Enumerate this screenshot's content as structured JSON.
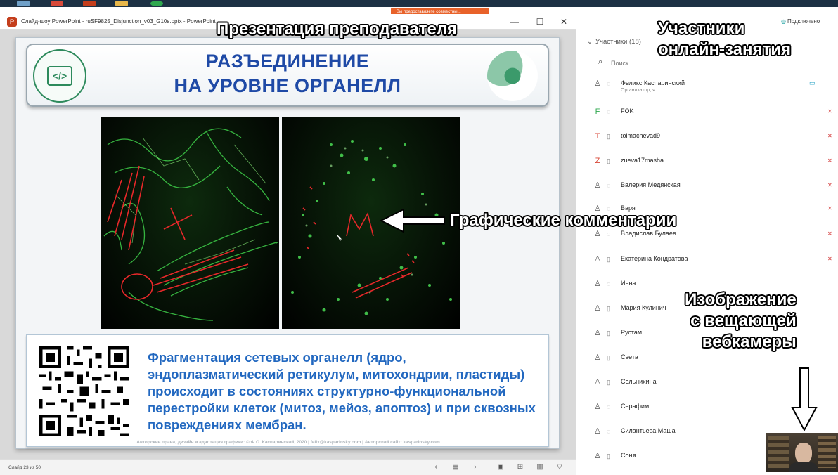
{
  "taskbar": {
    "share_notice": "Вы предоставляете совместны..."
  },
  "ppt_window": {
    "title": "Слайд-шоу PowerPoint - ruSF9825_Disjunction_v03_G10s.pptx - PowerPoint",
    "minimize_label": "—",
    "restore_label": "☐",
    "close_label": "✕",
    "slide": {
      "title_line1": "РАЗЪЕДИНЕНИЕ",
      "title_line2": "НА УРОВНЕ ОРГАНЕЛЛ",
      "body_text": "Фрагментация сетевых органелл (ядро, эндоплазматический ретикулум, митохондрии, пластиды) происходит в состояниях структурно-функциональной перестройки клеток (митоз, мейоз, апоптоз) и при сквозных повреждениях мембран.",
      "footer": "Авторские права, дизайн и адаптация графики: © Ф.О. Каспаринский, 2020 | felix@kasparinsky.com | Авторский сайт: kasparinsky.com"
    },
    "status": {
      "slide_counter": "Слайд 23 из 50",
      "prev_label": "‹",
      "notes_label": "▤",
      "next_label": "›",
      "normal_view_label": "▣",
      "sorter_view_label": "⊞",
      "reading_view_label": "▥",
      "slideshow_label": "▽"
    }
  },
  "panel": {
    "connected_label": "Подключено",
    "participants_header": "Участники (18)",
    "search_placeholder": "Поиск",
    "participants": [
      {
        "avatar": "♙",
        "name": "Феликс Каспаринский",
        "role": "Организатор, я",
        "device": "◌"
      },
      {
        "avatar": "F",
        "name": "FOK",
        "role": "",
        "device": "◌"
      },
      {
        "avatar": "T",
        "name": "tolmachevad9",
        "role": "",
        "device": "▯"
      },
      {
        "avatar": "Z",
        "name": "zueva17masha",
        "role": "",
        "device": "▯"
      },
      {
        "avatar": "♙",
        "name": "Валерия Медянская",
        "role": "",
        "device": "◌"
      },
      {
        "avatar": "♙",
        "name": "Варя",
        "role": "",
        "device": "◌"
      },
      {
        "avatar": "♙",
        "name": "Владислав Булаев",
        "role": "",
        "device": "◌"
      },
      {
        "avatar": "♙",
        "name": "Екатерина Кондратова",
        "role": "",
        "device": "▯"
      },
      {
        "avatar": "♙",
        "name": "Инна",
        "role": "",
        "device": "◌"
      },
      {
        "avatar": "♙",
        "name": "Мария Кулинич",
        "role": "",
        "device": "▯"
      },
      {
        "avatar": "♙",
        "name": "Рустам",
        "role": "",
        "device": "▯"
      },
      {
        "avatar": "♙",
        "name": "Света",
        "role": "",
        "device": "▯"
      },
      {
        "avatar": "♙",
        "name": "Сельнихина",
        "role": "",
        "device": "▯"
      },
      {
        "avatar": "♙",
        "name": "Серафим",
        "role": "",
        "device": "◌"
      },
      {
        "avatar": "♙",
        "name": "Силантьева Маша",
        "role": "",
        "device": "◌"
      },
      {
        "avatar": "♙",
        "name": "Соня",
        "role": "",
        "device": "▯"
      }
    ]
  },
  "annotations": {
    "presentation": "Презентация преподавателя",
    "participants_line1": "Участники",
    "participants_line2": "онлайн-занятия",
    "graphics": "Графические комментарии",
    "webcam_line1": "Изображение",
    "webcam_line2": "с вещающей",
    "webcam_line3": "вебкамеры"
  },
  "colors": {
    "slide_title": "#1f4aa6",
    "slide_body": "#2268c0",
    "ink_annotation": "#e8282a",
    "share_pill": "#e8622a",
    "taskbar": "#1d3144"
  }
}
